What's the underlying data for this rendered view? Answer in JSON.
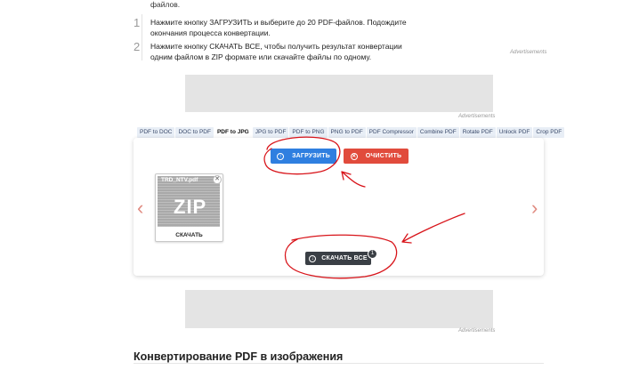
{
  "intro_tail": "файлов.",
  "steps": [
    {
      "num": "1",
      "text": "Нажмите кнопку ЗАГРУЗИТЬ и выберите до 20 PDF-файлов. Подождите окончания процесса конвертации."
    },
    {
      "num": "2",
      "text": "Нажмите кнопку СКАЧАТЬ ВСЕ, чтобы получить результат конвертации одним файлом в ZIP формате или скачайте файлы по одному."
    }
  ],
  "ads": {
    "label": "Advertisements"
  },
  "tabs": [
    "PDF to DOC",
    "DOC to PDF",
    "PDF to JPG",
    "JPG to PDF",
    "PDF to PNG",
    "PNG to PDF",
    "PDF Compressor",
    "Combine PDF",
    "Rotate PDF",
    "Unlock PDF",
    "Crop PDF"
  ],
  "active_tab": "PDF to JPG",
  "buttons": {
    "upload": "ЗАГРУЗИТЬ",
    "clear": "ОЧИСТИТЬ",
    "download_all": "СКАЧАТЬ ВСЕ"
  },
  "nav": {
    "prev": "‹",
    "next": "›"
  },
  "file_card": {
    "name": "TRD_NTV.pdf",
    "format": "ZIP",
    "download": "СКАЧАТЬ",
    "close": "✕"
  },
  "badge_count": "1",
  "section_title": "Конвертирование PDF в изображения",
  "colors": {
    "upload": "#2f7fe0",
    "clear": "#e14b3c",
    "download_all": "#3a3f45",
    "annotation": "#d8141a"
  }
}
